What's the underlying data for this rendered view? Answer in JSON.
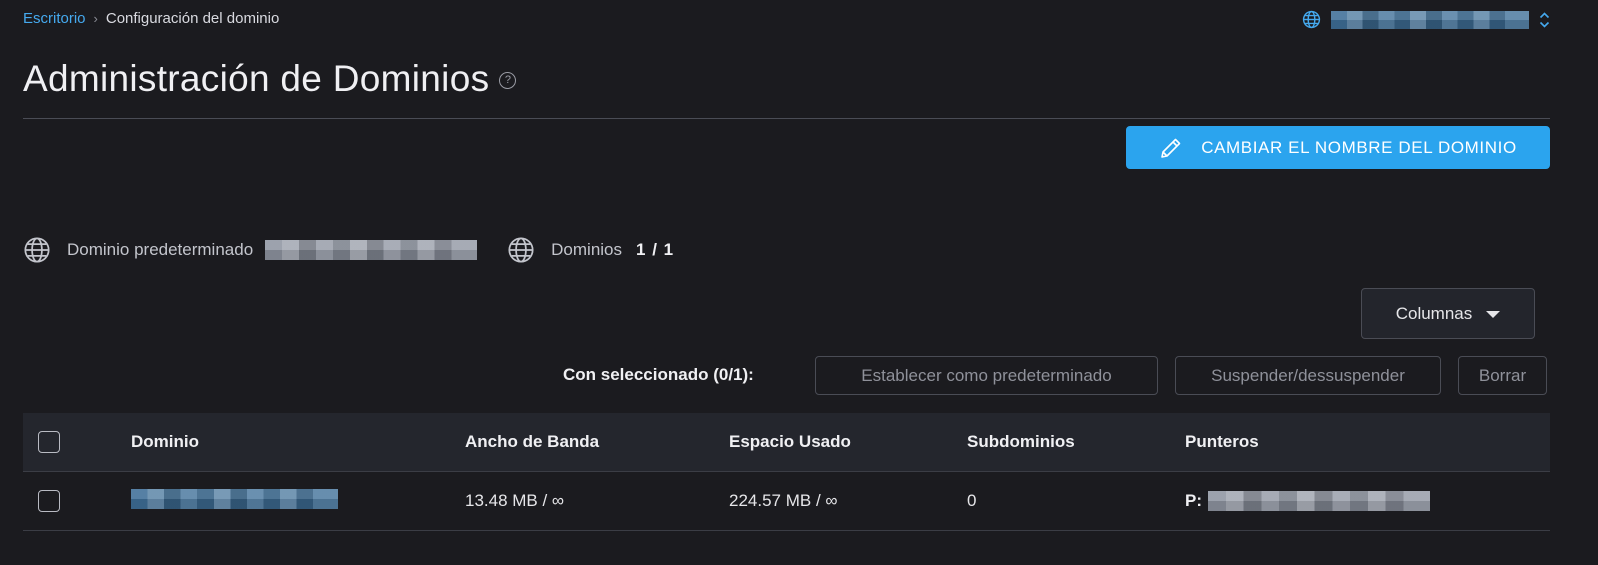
{
  "breadcrumb": {
    "home": "Escritorio",
    "separator": "›",
    "current": "Configuración del dominio"
  },
  "domain_switcher": {
    "icon": "globe-icon",
    "value": "",
    "chevron": "chevron-updown-icon"
  },
  "page": {
    "title": "Administración de Dominios",
    "help_icon": "?"
  },
  "actions": {
    "rename_label": "CAMBIAR EL NOMBRE DEL DOMINIO",
    "rename_icon": "pencil-icon"
  },
  "info": {
    "default_domain_label": "Dominio predeterminado",
    "default_domain_value": "",
    "domains_label": "Dominios",
    "domains_count": "1 / 1"
  },
  "columns_button": {
    "label": "Columnas"
  },
  "bulk": {
    "label": "Con seleccionado (0/1):",
    "set_default": "Establecer como predeterminado",
    "suspend": "Suspender/dessuspender",
    "delete": "Borrar"
  },
  "table": {
    "headers": {
      "domain": "Dominio",
      "bandwidth": "Ancho de Banda",
      "space": "Espacio Usado",
      "subdomains": "Subdominios",
      "pointers": "Punteros"
    },
    "rows": [
      {
        "domain": "",
        "bandwidth": "13.48 MB / ∞",
        "space": "224.57 MB / ∞",
        "subdomains": "0",
        "pointers_prefix": "P:",
        "pointers": ""
      }
    ]
  },
  "colors": {
    "background": "#1b1b1f",
    "accent": "#2ba4ee",
    "link": "#45a9ee",
    "table_header": "#24262d"
  }
}
